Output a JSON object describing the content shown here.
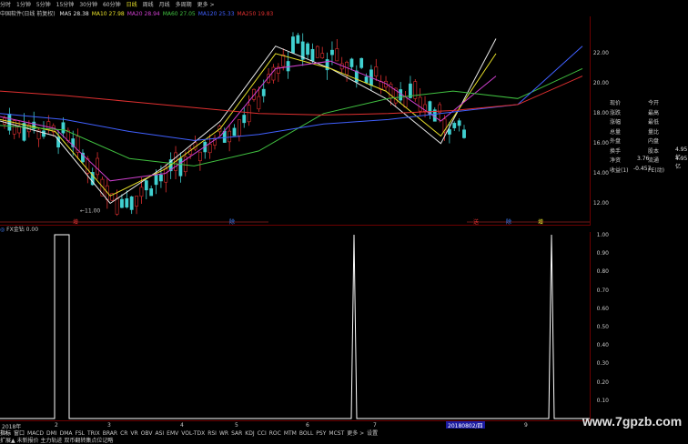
{
  "periods": [
    "分时",
    "1分钟",
    "5分钟",
    "15分钟",
    "30分钟",
    "60分钟",
    "日线",
    "周线",
    "月线",
    "多周期",
    "更多 >"
  ],
  "active_period": "日线",
  "stock_title": "中国软件(日线 前复权)",
  "ma": [
    {
      "label": "MA5",
      "value": "28.38",
      "color": "#e8e8e8"
    },
    {
      "label": "MA10",
      "value": "27.98",
      "color": "#e8e02a"
    },
    {
      "label": "MA20",
      "value": "28.94",
      "color": "#d040d0"
    },
    {
      "label": "MA60",
      "value": "27.05",
      "color": "#40c040"
    },
    {
      "label": "MA120",
      "value": "25.33",
      "color": "#4060ff"
    },
    {
      "label": "MA250",
      "value": "19.83",
      "color": "#e03030"
    }
  ],
  "price_axis": [
    "22.00",
    "20.00",
    "18.00",
    "16.00",
    "14.00",
    "12.00"
  ],
  "annotations": {
    "low_price": "11.00"
  },
  "chart_markers": [
    {
      "text": "增",
      "color": "#e03030"
    },
    {
      "text": "除",
      "color": "#4080ff"
    },
    {
      "text": "送",
      "color": "#e03030"
    },
    {
      "text": "除",
      "color": "#4080ff"
    },
    {
      "text": "增",
      "color": "#e8e02a"
    }
  ],
  "info_panel": [
    [
      "现价",
      "今开"
    ],
    [
      "涨跌",
      "最高"
    ],
    [
      "涨幅",
      "最低"
    ],
    [
      "总量",
      "量比"
    ],
    [
      "外盘",
      "内盘"
    ],
    [
      "换手",
      "股本"
    ],
    [
      "净资",
      "流通"
    ],
    [
      "收益(1)",
      "PE(动)"
    ]
  ],
  "info_values": {
    "guben": "4.95亿",
    "jingzi": "3.76",
    "liutong": "4.95亿",
    "shouyi": "-0.457"
  },
  "sub_indicator": {
    "title": "FX金钻",
    "value": "0.00"
  },
  "sub_axis": [
    "1.00",
    "0.90",
    "0.80",
    "0.70",
    "0.60",
    "0.50",
    "0.40",
    "0.30",
    "0.20",
    "0.10"
  ],
  "date_labels": [
    "2018年",
    "2",
    "3",
    "4",
    "5",
    "6",
    "7",
    "8",
    "9"
  ],
  "date_highlight": "20180802/四",
  "tabs": [
    "指标",
    "窗口",
    "MACD",
    "DMI",
    "DMA",
    "FSL",
    "TRIX",
    "BRAR",
    "CR",
    "VR",
    "OBV",
    "ASI",
    "EMV",
    "VOL-TDX",
    "RSI",
    "WR",
    "SAR",
    "KDJ",
    "CCI",
    "ROC",
    "MTM",
    "BOLL",
    "PSY",
    "MCST",
    "更多 >",
    "设置"
  ],
  "selected_tab": "指标",
  "status": "扩展▲ 未新报价 主力轨迹 双币翻转集点位记略",
  "watermark": "www.7gpzb.com",
  "chart_data": {
    "type": "line",
    "title": "中国软件(日线 前复权)",
    "x": [
      "2018年",
      "2",
      "3",
      "4",
      "5",
      "6",
      "7",
      "8",
      "9"
    ],
    "series": [
      {
        "name": "MA5",
        "values": [
          17.5,
          16.5,
          12.0,
          14.5,
          17.5,
          22.5,
          21.0,
          19.0,
          16.0,
          23.0
        ]
      },
      {
        "name": "MA10",
        "values": [
          17.6,
          16.8,
          12.5,
          14.3,
          17.0,
          22.0,
          21.0,
          19.5,
          16.5,
          22.0
        ]
      },
      {
        "name": "MA20",
        "values": [
          17.8,
          17.0,
          13.5,
          14.0,
          16.5,
          21.0,
          21.5,
          20.0,
          17.5,
          20.5
        ]
      },
      {
        "name": "MA60",
        "values": [
          17.2,
          16.9,
          15.0,
          14.5,
          15.5,
          18.0,
          19.0,
          19.5,
          19.0,
          21.0
        ]
      },
      {
        "name": "MA120",
        "values": [
          18.0,
          17.6,
          16.8,
          16.2,
          16.6,
          17.3,
          17.6,
          18.1,
          18.6,
          22.5
        ]
      },
      {
        "name": "MA250",
        "values": [
          19.5,
          19.2,
          18.8,
          18.4,
          18.0,
          17.9,
          18.0,
          18.2,
          18.6,
          20.5
        ]
      }
    ],
    "ylim": [
      11,
      24
    ],
    "ylabel": "",
    "xlabel": ""
  }
}
